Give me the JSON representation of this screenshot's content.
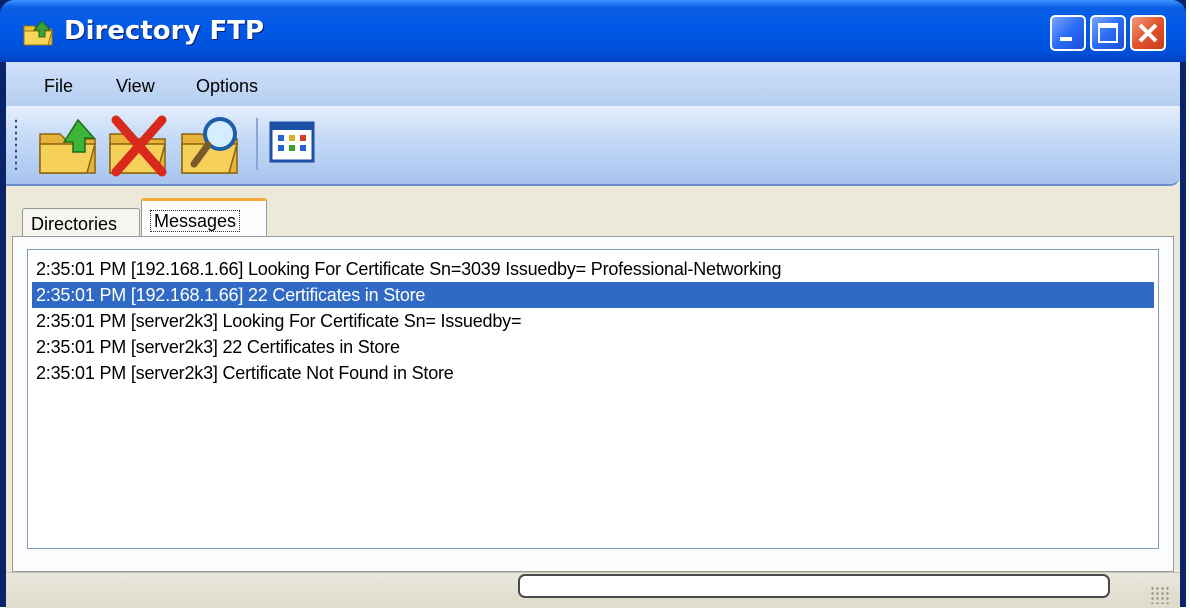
{
  "window": {
    "title": "Directory FTP",
    "accent": "#0058e6"
  },
  "menu": {
    "items": [
      "File",
      "View",
      "Options"
    ]
  },
  "toolbar": {
    "buttons": [
      "upload-folder-icon",
      "delete-icon",
      "search-folder-icon",
      "columns-view-icon"
    ]
  },
  "tabs": [
    {
      "label": "Directories",
      "active": false
    },
    {
      "label": "Messages",
      "active": true
    }
  ],
  "messages": {
    "selected_index": 1,
    "selected_color": "#316ac5",
    "rows": [
      "2:35:01 PM [192.168.1.66]  Looking For Certificate Sn=3039 Issuedby= Professional-Networking",
      "2:35:01 PM [192.168.1.66] 22 Certificates in Store",
      "2:35:01 PM [server2k3]  Looking For Certificate Sn= Issuedby=",
      "2:35:01 PM [server2k3] 22 Certificates in Store",
      "2:35:01 PM [server2k3] Certificate Not Found in Store"
    ]
  },
  "status": {
    "progress_fraction": 0
  }
}
